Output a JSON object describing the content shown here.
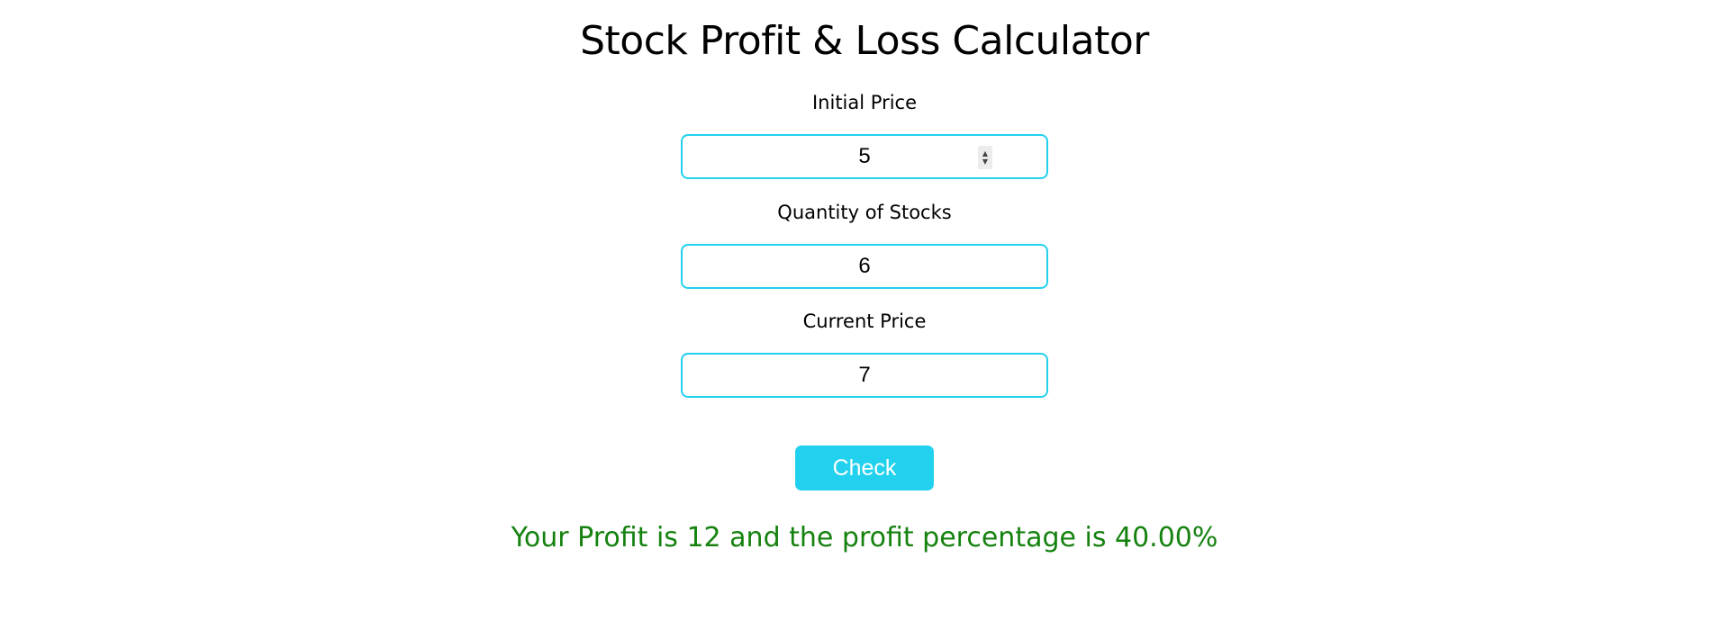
{
  "app": {
    "title": "Stock Profit & Loss Calculator"
  },
  "fields": {
    "initial_price": {
      "label": "Initial Price",
      "value": "5"
    },
    "quantity": {
      "label": "Quantity of Stocks",
      "value": "6"
    },
    "current_price": {
      "label": "Current Price",
      "value": "7"
    }
  },
  "actions": {
    "check_label": "Check"
  },
  "result": {
    "message": "Your Profit is 12 and the profit percentage is 40.00%",
    "color": "#15820f"
  },
  "theme": {
    "accent": "#22d1ee"
  }
}
